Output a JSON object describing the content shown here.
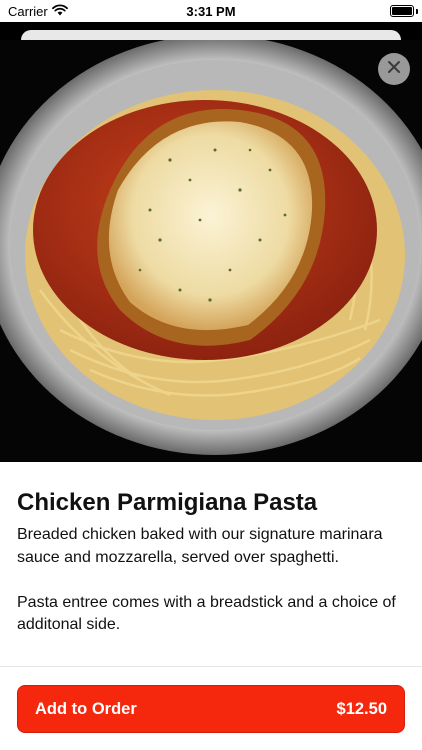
{
  "status_bar": {
    "carrier": "Carrier",
    "time": "3:31 PM"
  },
  "item": {
    "title": "Chicken Parmigiana Pasta",
    "description": "Breaded chicken baked with our signature marinara sauce and mozzarella, served over spaghetti.\n\nPasta entree comes with a breadstick and a choice of additonal side."
  },
  "footer": {
    "add_label": "Add to Order",
    "price": "$12.50"
  },
  "colors": {
    "accent": "#f5280e"
  },
  "icons": {
    "close": "close-icon",
    "wifi": "wifi-icon",
    "battery": "battery-icon"
  }
}
